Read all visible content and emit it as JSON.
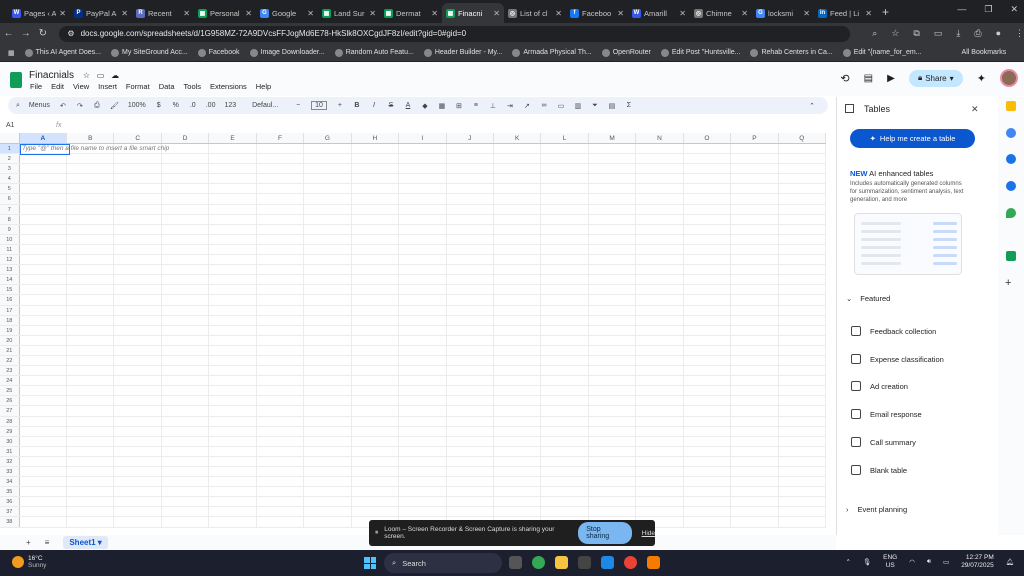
{
  "browser": {
    "tabs": [
      {
        "label": "Pages ‹ A",
        "color": "#3858e9",
        "glyph": "W"
      },
      {
        "label": "PayPal A",
        "color": "#003087",
        "glyph": "P"
      },
      {
        "label": "Recent",
        "color": "#5c6bc0",
        "glyph": "R"
      },
      {
        "label": "Personal",
        "color": "#0f9d58",
        "glyph": "▦"
      },
      {
        "label": "Google",
        "color": "#4285f4",
        "glyph": "G"
      },
      {
        "label": "Land Sur",
        "color": "#0f9d58",
        "glyph": "▦"
      },
      {
        "label": "Dermat",
        "color": "#0f9d58",
        "glyph": "▦"
      },
      {
        "label": "Finacni",
        "color": "#0f9d58",
        "glyph": "▦"
      },
      {
        "label": "List of cl",
        "color": "#777777",
        "glyph": "◎"
      },
      {
        "label": "Faceboo",
        "color": "#1877f2",
        "glyph": "f"
      },
      {
        "label": "Amarill",
        "color": "#3858e9",
        "glyph": "W"
      },
      {
        "label": "Chimne",
        "color": "#777777",
        "glyph": "◎"
      },
      {
        "label": "locksmi",
        "color": "#4285f4",
        "glyph": "G"
      },
      {
        "label": "Feed | Li",
        "color": "#0a66c2",
        "glyph": "in"
      }
    ],
    "active_tab_index": 7,
    "url": "docs.google.com/spreadsheets/d/1G958MZ-72A9DVcsFFJogMd6E78-HkSlk8OXCgdJF8zI/edit?gid=0#gid=0",
    "bookmarks": [
      "This AI Agent Does...",
      "My SiteGround Acc...",
      "Facebook",
      "Image Downloader...",
      "Random Auto Featu...",
      "Header Builder - My...",
      "Armada Physical Th...",
      "OpenRouter",
      "Edit Post \"Huntsville...",
      "Rehab Centers in Ca...",
      "Edit \"{name_for_em..."
    ],
    "all_bookmarks": "All Bookmarks"
  },
  "sheets": {
    "title": "Finacnials",
    "menu": [
      "File",
      "Edit",
      "View",
      "Insert",
      "Format",
      "Data",
      "Tools",
      "Extensions",
      "Help"
    ],
    "share_label": "Share",
    "toolbar": {
      "menus": "Menus",
      "zoom": "100%",
      "currency": "$",
      "percent": "%",
      "dec_less": ".0",
      "dec_more": ".00",
      "format_123": "123",
      "font": "Defaul...",
      "font_size": "10"
    },
    "name_box": "A1",
    "fx": "fx",
    "columns": [
      "A",
      "B",
      "C",
      "D",
      "E",
      "F",
      "G",
      "H",
      "I",
      "J",
      "K",
      "L",
      "M",
      "N",
      "O",
      "P",
      "Q"
    ],
    "rows": [
      "1",
      "2",
      "3",
      "4",
      "5",
      "6",
      "7",
      "8",
      "9",
      "10",
      "11",
      "12",
      "13",
      "14",
      "15",
      "16",
      "17",
      "18",
      "19",
      "20",
      "21",
      "22",
      "23",
      "24",
      "25",
      "26",
      "27",
      "28",
      "29",
      "30",
      "31",
      "32",
      "33",
      "34",
      "35",
      "36",
      "37",
      "38"
    ],
    "a1_hint": "Type \"@\" then a file name to insert a file smart chip",
    "sheet_tab": "Sheet1"
  },
  "panel": {
    "title": "Tables",
    "create_button": "Help me create a table",
    "new_label": "NEW",
    "new_title": "AI enhanced tables",
    "new_desc": "Includes automatically generated columns for summarization, sentiment analysis, text generation, and more",
    "featured": "Featured",
    "items": [
      "Feedback collection",
      "Expense classification",
      "Ad creation",
      "Email response",
      "Call summary",
      "Blank table"
    ],
    "event": "Event planning"
  },
  "loom": {
    "message": "Loom – Screen Recorder & Screen Capture is sharing your screen.",
    "stop": "Stop sharing",
    "hide": "Hide"
  },
  "taskbar": {
    "temp": "16°C",
    "weather": "Sunny",
    "search": "Search",
    "lang": "ENG",
    "region": "US",
    "time": "12:27 PM",
    "date": "29/07/2025"
  }
}
